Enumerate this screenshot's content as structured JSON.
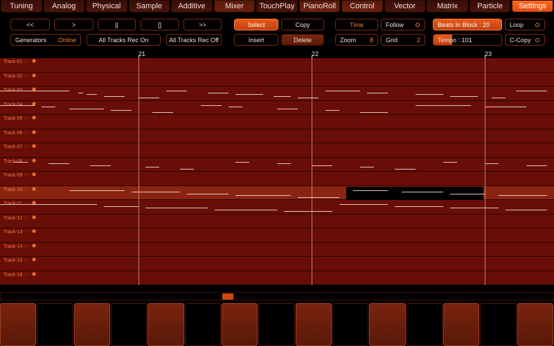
{
  "tabs": [
    {
      "label": "Tuning",
      "state": "normal"
    },
    {
      "label": "Analog",
      "state": "normal"
    },
    {
      "label": "Physical",
      "state": "normal"
    },
    {
      "label": "Sample",
      "state": "normal"
    },
    {
      "label": "Additive",
      "state": "normal"
    },
    {
      "label": "Mixer",
      "state": "alt"
    },
    {
      "label": "TouchPlay",
      "state": "normal"
    },
    {
      "label": "PianoRoll",
      "state": "alt"
    },
    {
      "label": "Control",
      "state": "alt"
    },
    {
      "label": "Vector",
      "state": "normal"
    },
    {
      "label": "Matrix",
      "state": "normal"
    },
    {
      "label": "Particle",
      "state": "normal"
    },
    {
      "label": "Settings",
      "state": "active"
    }
  ],
  "transport": {
    "rewind": "<<",
    "play": ">",
    "pause": "||",
    "stop": "[]",
    "forward": ">>"
  },
  "generators": {
    "label": "Generators",
    "status": "Online"
  },
  "rec": {
    "on": "All Tracks Rec On",
    "off": "All Tracks Rec Off"
  },
  "edit": {
    "select": "Select",
    "copy": "Copy",
    "insert": "Insert",
    "delete": "Delete"
  },
  "view": {
    "time": "Time",
    "follow": "Follow",
    "zoom_label": "Zoom",
    "zoom_value": "8",
    "grid_label": "Grid",
    "grid_value": "2"
  },
  "block": {
    "beats_label": "Beats In Block : 20",
    "loop": "Loop",
    "tempo_label": "Tempo : 101",
    "tempo_level": 0.28,
    "ccopy": "C-Copy"
  },
  "ruler": {
    "bars": [
      "21",
      "22",
      "23"
    ]
  },
  "tracks": [
    "Track-01 : -",
    "Track-02 : -",
    "Track-03 : -",
    "Track-04 : -",
    "Track-05 : -",
    "Track-06 : -",
    "Track-07 : -",
    "Track-08 : -",
    "Track-09 : -",
    "Track-10 : -",
    "Track-11 : -",
    "Track-12 : -",
    "Track-13 : -",
    "Track-14 : -",
    "Track-15 : -",
    "Track-16 : -"
  ],
  "selected_track": 9,
  "scroll_position": 0.41,
  "keyboard": {
    "key_count": 15,
    "colors": [
      "w",
      "b",
      "w",
      "b",
      "w",
      "b",
      "w",
      "b",
      "w",
      "b",
      "w",
      "b",
      "w",
      "b",
      "w"
    ]
  }
}
